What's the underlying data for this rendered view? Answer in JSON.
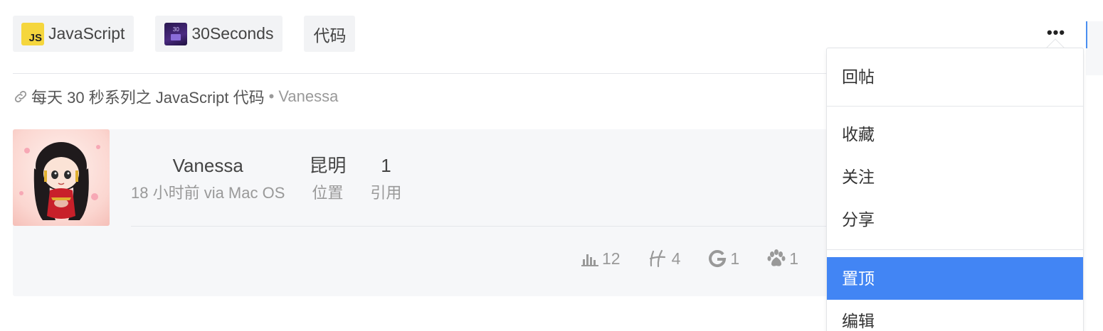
{
  "tags": [
    {
      "label": "JavaScript",
      "icon": "javascript-logo-icon",
      "icon_text": "JS"
    },
    {
      "label": "30Seconds",
      "icon": "30seconds-logo-icon",
      "icon_text": "30"
    },
    {
      "label": "代码",
      "icon": ""
    }
  ],
  "more_button": {
    "label": "•••"
  },
  "article": {
    "title": "每天 30 秒系列之 JavaScript 代码",
    "separator": "•",
    "author": "Vanessa"
  },
  "post": {
    "username": "Vanessa",
    "time": "18 小时前 via Mac OS",
    "location_value": "昆明",
    "location_label": "位置",
    "quote_value": "1",
    "quote_label": "引用"
  },
  "counters": [
    {
      "icon": "bar-chart-icon",
      "value": "12"
    },
    {
      "icon": "hacpai-h-icon",
      "value": "4"
    },
    {
      "icon": "google-g-icon",
      "value": "1"
    },
    {
      "icon": "paw-icon",
      "value": "1"
    }
  ],
  "menu": {
    "items": [
      "回帖",
      "收藏",
      "关注",
      "分享",
      "置顶",
      "编辑"
    ],
    "active_item": "置顶"
  },
  "colors": {
    "accent": "#4285f4",
    "card_bg": "#f6f7f9",
    "tag_bg": "#f2f3f5",
    "muted_text": "#999999"
  }
}
